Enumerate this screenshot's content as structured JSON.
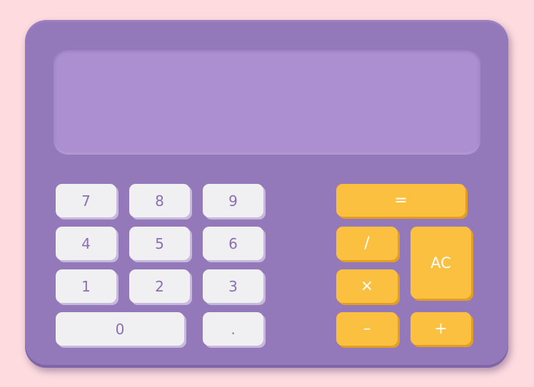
{
  "display": {
    "value": ""
  },
  "keys": {
    "seven": "7",
    "eight": "8",
    "nine": "9",
    "four": "4",
    "five": "5",
    "six": "6",
    "one": "1",
    "two": "2",
    "three": "3",
    "zero": "0",
    "decimal": ".",
    "equals": "=",
    "divide": "/",
    "multiply": "×",
    "subtract": "–",
    "add": "+",
    "clear": "AC"
  },
  "colors": {
    "background": "#fddbdf",
    "body": "#9378ba",
    "display": "#ab8fd0",
    "number_key": "#f0eff1",
    "number_text": "#8b6fb1",
    "operator_key": "#fcc040",
    "operator_text": "#ffffff"
  }
}
